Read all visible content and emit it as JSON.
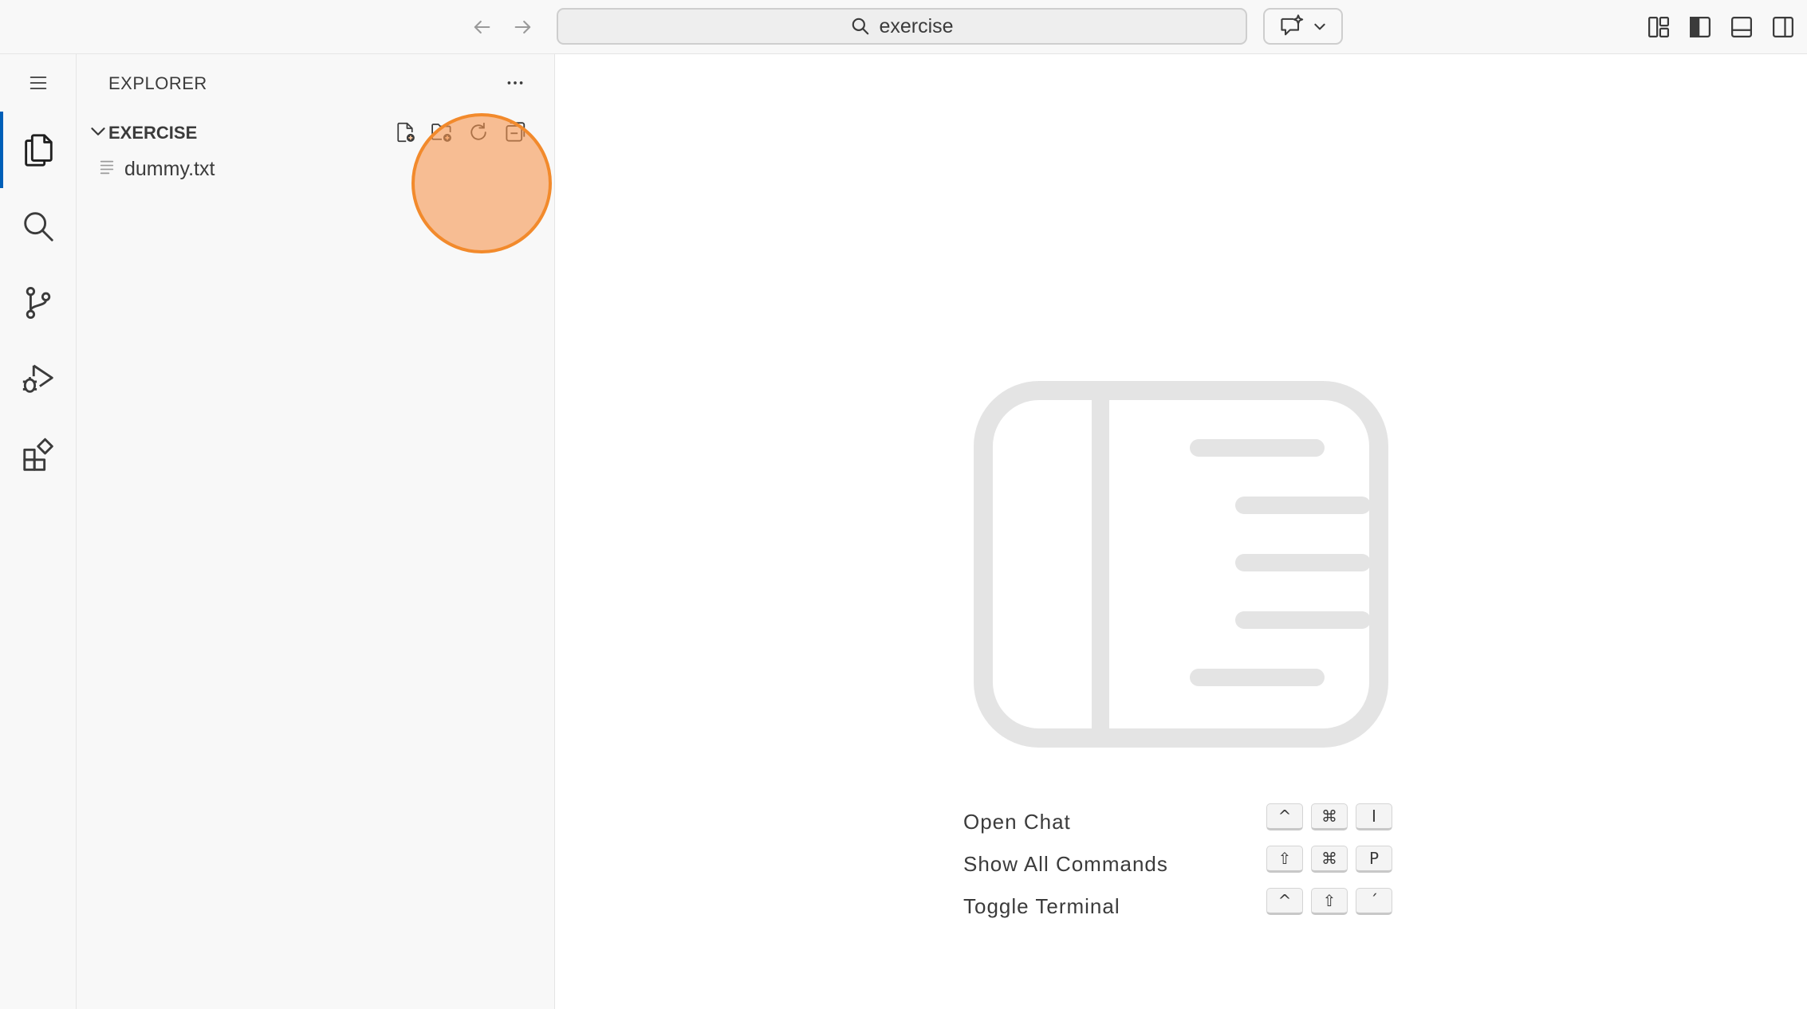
{
  "titlebar": {
    "search_text": "exercise",
    "icons": [
      "arrow-left-icon",
      "arrow-right-icon",
      "search-icon",
      "chat-sparkle-icon",
      "chevron-down-icon",
      "customize-layout-icon",
      "toggle-primary-sidebar-icon",
      "toggle-panel-icon",
      "toggle-secondary-sidebar-icon"
    ]
  },
  "activitybar": {
    "items": [
      "menu",
      "explorer",
      "search",
      "source-control",
      "run-and-debug",
      "extensions"
    ],
    "active": "explorer",
    "accent_color": "#005fb8"
  },
  "sidebar": {
    "title": "EXPLORER",
    "folder": {
      "name": "EXERCISE",
      "actions": [
        "new-file",
        "new-folder",
        "refresh",
        "collapse-all"
      ]
    },
    "files": [
      {
        "name": "dummy.txt"
      }
    ],
    "highlight_color": "#f28a2c"
  },
  "editor": {
    "shortcuts": [
      {
        "label": "Open Chat",
        "keys": [
          "^",
          "⌘",
          "I"
        ]
      },
      {
        "label": "Show All Commands",
        "keys": [
          "⇧",
          "⌘",
          "P"
        ]
      },
      {
        "label": "Toggle Terminal",
        "keys": [
          "^",
          "⇧",
          "ˊ"
        ]
      }
    ]
  }
}
